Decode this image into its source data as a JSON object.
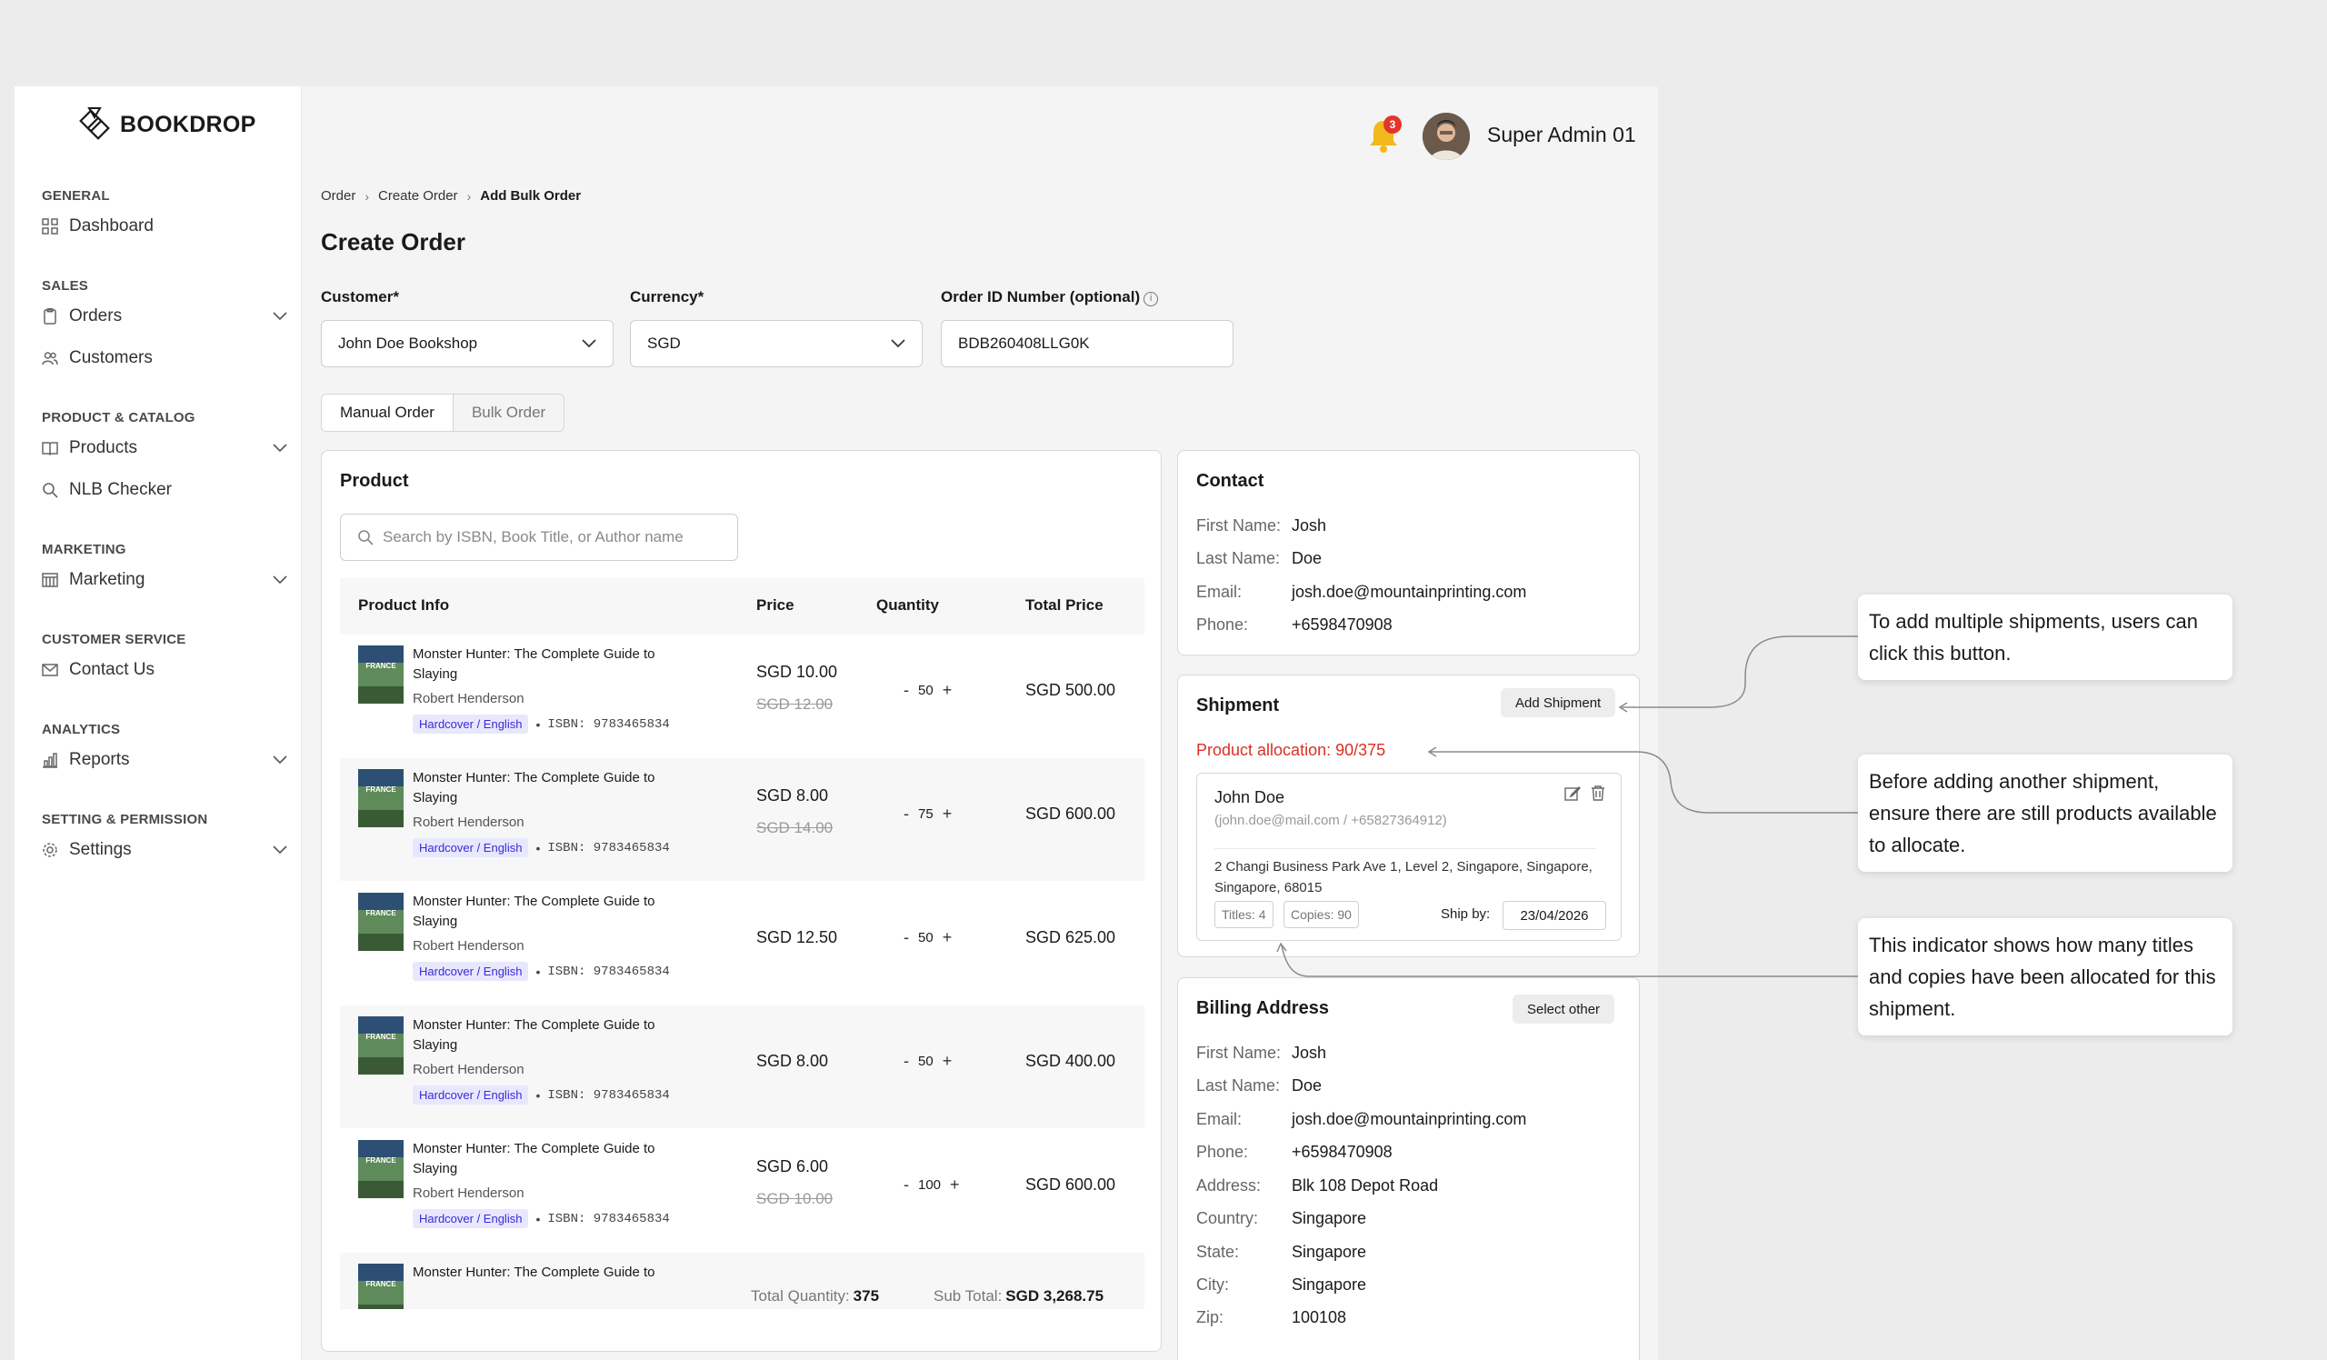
{
  "brand": {
    "name": "BOOKDROP"
  },
  "header": {
    "notification_count": "3",
    "user_name": "Super Admin 01"
  },
  "sidebar": {
    "groups": [
      {
        "title": "GENERAL",
        "items": [
          {
            "label": "Dashboard",
            "icon": "grid-icon"
          }
        ]
      },
      {
        "title": "SALES",
        "items": [
          {
            "label": "Orders",
            "icon": "clipboard-icon",
            "expandable": true
          },
          {
            "label": "Customers",
            "icon": "users-icon"
          }
        ]
      },
      {
        "title": "PRODUCT & CATALOG",
        "items": [
          {
            "label": "Products",
            "icon": "book-open-icon",
            "expandable": true
          },
          {
            "label": "NLB Checker",
            "icon": "search-icon"
          }
        ]
      },
      {
        "title": "MARKETING",
        "items": [
          {
            "label": "Marketing",
            "icon": "calendar-icon",
            "expandable": true
          }
        ]
      },
      {
        "title": "CUSTOMER SERVICE",
        "items": [
          {
            "label": "Contact Us",
            "icon": "mail-icon"
          }
        ]
      },
      {
        "title": "ANALYTICS",
        "items": [
          {
            "label": "Reports",
            "icon": "bar-chart-icon",
            "expandable": true
          }
        ]
      },
      {
        "title": "SETTING & PERMISSION",
        "items": [
          {
            "label": "Settings",
            "icon": "gear-icon",
            "expandable": true
          }
        ]
      }
    ]
  },
  "breadcrumb": [
    "Order",
    "Create Order",
    "Add Bulk Order"
  ],
  "page_title": "Create Order",
  "form": {
    "customer_label": "Customer*",
    "customer_value": "John Doe Bookshop",
    "currency_label": "Currency*",
    "currency_value": "SGD",
    "order_id_label": "Order ID Number (optional)",
    "order_id_value": "BDB260408LLG0K"
  },
  "tabs": [
    "Manual Order",
    "Bulk Order"
  ],
  "product": {
    "title": "Product",
    "search_placeholder": "Search by ISBN, Book Title, or Author name",
    "columns": [
      "Product Info",
      "Price",
      "Quantity",
      "Total Price"
    ],
    "rows": [
      {
        "title": "Monster Hunter: The Complete Guide to Slaying",
        "author": "Robert Henderson",
        "format": "Hardcover / English",
        "isbn": "ISBN: 9783465834",
        "price": "SGD 10.00",
        "old_price": "SGD 12.00",
        "qty": "50",
        "total": "SGD 500.00"
      },
      {
        "title": "Monster Hunter: The Complete Guide to Slaying",
        "author": "Robert Henderson",
        "format": "Hardcover / English",
        "isbn": "ISBN: 9783465834",
        "price": "SGD 8.00",
        "old_price": "SGD 14.00",
        "qty": "75",
        "total": "SGD 600.00"
      },
      {
        "title": "Monster Hunter: The Complete Guide to Slaying",
        "author": "Robert Henderson",
        "format": "Hardcover / English",
        "isbn": "ISBN: 9783465834",
        "price": "SGD 12.50",
        "old_price": "",
        "qty": "50",
        "total": "SGD 625.00"
      },
      {
        "title": "Monster Hunter: The Complete Guide to Slaying",
        "author": "Robert Henderson",
        "format": "Hardcover / English",
        "isbn": "ISBN: 9783465834",
        "price": "SGD 8.00",
        "old_price": "",
        "qty": "50",
        "total": "SGD 400.00"
      },
      {
        "title": "Monster Hunter: The Complete Guide to Slaying",
        "author": "Robert Henderson",
        "format": "Hardcover / English",
        "isbn": "ISBN: 9783465834",
        "price": "SGD 6.00",
        "old_price": "SGD 10.00",
        "qty": "100",
        "total": "SGD 600.00"
      },
      {
        "title": "Monster Hunter: The Complete Guide to",
        "author": "",
        "format": "",
        "isbn": "",
        "price": "",
        "old_price": "",
        "qty": "",
        "total": ""
      }
    ],
    "total_quantity_label": "Total Quantity:",
    "total_quantity": "375",
    "subtotal_label": "Sub Total:",
    "subtotal": "SGD 3,268.75"
  },
  "contact": {
    "title": "Contact",
    "fields": [
      {
        "k": "First Name:",
        "v": "Josh"
      },
      {
        "k": "Last Name:",
        "v": "Doe"
      },
      {
        "k": "Email:",
        "v": "josh.doe@mountainprinting.com"
      },
      {
        "k": "Phone:",
        "v": "+6598470908"
      }
    ]
  },
  "shipment": {
    "title": "Shipment",
    "add_button": "Add Shipment",
    "allocation": "Product allocation: 90/375",
    "name": "John Doe",
    "sub": "(john.doe@mail.com / +65827364912)",
    "address": "2 Changi Business Park Ave 1, Level 2, Singapore, Singapore, Singapore, 68015",
    "titles": "Titles: 4",
    "copies": "Copies: 90",
    "ship_by_label": "Ship by:",
    "ship_by_date": "23/04/2026"
  },
  "billing": {
    "title": "Billing Address",
    "select_button": "Select other",
    "fields": [
      {
        "k": "First Name:",
        "v": "Josh"
      },
      {
        "k": "Last Name:",
        "v": "Doe"
      },
      {
        "k": "Email:",
        "v": "josh.doe@mountainprinting.com"
      },
      {
        "k": "Phone:",
        "v": "+6598470908"
      },
      {
        "k": "Address:",
        "v": "Blk 108 Depot Road"
      },
      {
        "k": "Country:",
        "v": "Singapore"
      },
      {
        "k": "State:",
        "v": "Singapore"
      },
      {
        "k": "City:",
        "v": "Singapore"
      },
      {
        "k": "Zip:",
        "v": "100108"
      }
    ]
  },
  "annotations": [
    "To add multiple shipments, users can click this button.",
    "Before adding another shipment, ensure there are still products available to allocate.",
    "This indicator shows how many titles and copies have been allocated for this shipment."
  ],
  "colors": {
    "alert": "#d93025",
    "badge_bg": "#e9e7fd",
    "badge_text": "#3a2ad8",
    "bell": "#f2b81c"
  }
}
